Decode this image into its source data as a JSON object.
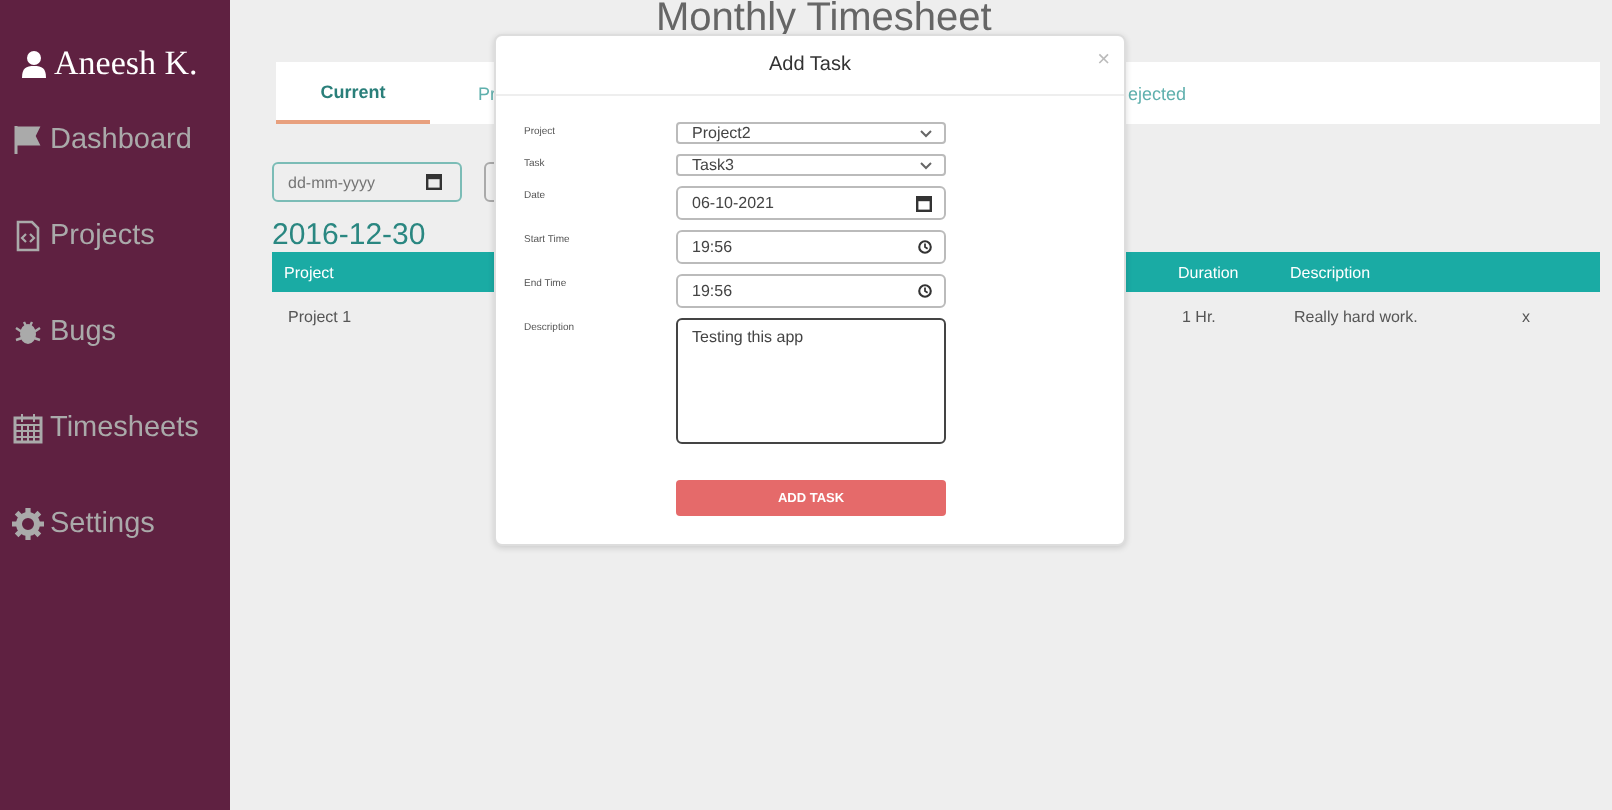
{
  "sidebar": {
    "user": "Aneesh K.",
    "items": [
      {
        "label": "Dashboard"
      },
      {
        "label": "Projects"
      },
      {
        "label": "Bugs"
      },
      {
        "label": "Timesheets"
      },
      {
        "label": "Settings"
      }
    ]
  },
  "title": "Monthly Timesheet",
  "tabs": [
    {
      "label": "Current",
      "selected": true
    },
    {
      "label": "Pr",
      "selected": false
    },
    {
      "label": "ejected",
      "selected": false
    }
  ],
  "filter": {
    "placeholder": "dd-mm-yyyy"
  },
  "date_heading": "2016-12-30",
  "table": {
    "columns": [
      "Project",
      "Duration",
      "Description"
    ],
    "rows": [
      {
        "project": "Project 1",
        "duration": "1 Hr.",
        "description": "Really hard work.",
        "action": "x"
      }
    ]
  },
  "modal": {
    "title": "Add Task",
    "close": "×",
    "fields": [
      {
        "label": "Project",
        "kind": "select",
        "value": "Project2"
      },
      {
        "label": "Task",
        "kind": "select",
        "value": "Task3"
      },
      {
        "label": "Date",
        "kind": "date",
        "value": "06-10-2021"
      },
      {
        "label": "Start Time",
        "kind": "time",
        "value": "19:56"
      },
      {
        "label": "End Time",
        "kind": "time",
        "value": "19:56"
      },
      {
        "label": "Description",
        "kind": "textarea",
        "value": "Testing this app"
      }
    ],
    "button": "ADD TASK"
  }
}
